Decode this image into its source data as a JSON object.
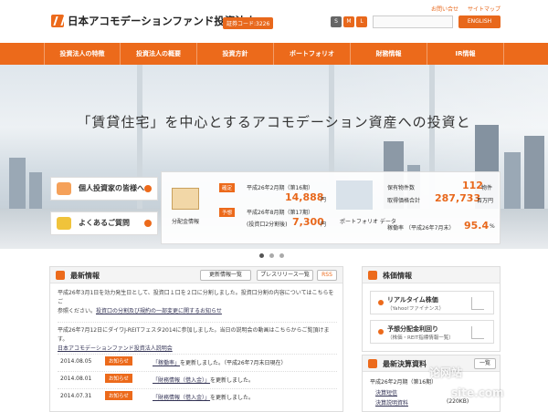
{
  "header": {
    "logo_text": "日本アコモデーションファンド投資法人",
    "stock_code": "証券コード:3226",
    "top_links": [
      "お問い合せ",
      "サイトマップ"
    ],
    "font_sizes": [
      "S",
      "M",
      "L"
    ],
    "english_button": "ENGLISH"
  },
  "nav": {
    "items": [
      "投資法人の特徴",
      "投資法人の概要",
      "投資方針",
      "ポートフォリオ",
      "財務情報",
      "IR情報"
    ]
  },
  "hero": {
    "headline": "「賃貸住宅」を中心とするアコモデーション資産への投資と",
    "left_buttons": [
      "個人投資家の皆様へ",
      "よくあるご質問"
    ],
    "distribution": {
      "label": "分配金情報",
      "confirmed_tag": "確定",
      "confirmed_period": "平成26年2月期（第16期）",
      "confirmed_amount": "14,888",
      "confirmed_unit": "円",
      "forecast_tag": "予想",
      "forecast_period": "平成26年8月期（第17期）",
      "forecast_note": "(投資口2分割後)",
      "forecast_amount": "7,300",
      "forecast_unit": "円"
    },
    "portfolio": {
      "label": "ポートフォリオ データ",
      "holdings_label": "保有物件数",
      "holdings_value": "112",
      "holdings_unit": "物件",
      "acquisition_label": "取得価格合計",
      "acquisition_value": "287,733",
      "acquisition_unit": "百万円",
      "occupancy_label": "稼働率",
      "occupancy_period": "（平成26年7月末）",
      "occupancy_value": "95.4",
      "occupancy_unit": "%"
    }
  },
  "news": {
    "title": "最新情報",
    "buttons": [
      "更新情報一覧",
      "プレスリリース一覧",
      "RSS"
    ],
    "notice1_line1": "平成26年3月1日を効力発生日として、投資口１口を２口に分割しました。投資口分割の内容についてはこちらをご",
    "notice1_line2_prefix": "参照ください。",
    "notice1_link": "投資口の分割及び規約の一部変更に関するお知らせ",
    "notice2_line1": "平成26年7月12日にダイワJ-REITフェスタ2014に参加しました。当日の説明会の動画はこちらからご覧頂けます。",
    "notice2_link": "日本アコモデーションファンド投資法人説明会",
    "rows": [
      {
        "date": "2014.08.05",
        "badge": "お知らせ",
        "text_link": "「稼働率」",
        "text": "を更新しました。（平成26年7月末日現在）"
      },
      {
        "date": "2014.08.01",
        "badge": "お知らせ",
        "text_link": "「財務情報（借入金）」",
        "text": "を更新しました。"
      },
      {
        "date": "2014.07.31",
        "badge": "お知らせ",
        "text_link": "「財務情報（借入金）」",
        "text": "を更新しました。"
      }
    ]
  },
  "stock": {
    "title": "株価情報",
    "realtime_title": "リアルタイム株価",
    "realtime_sub": "（Yahoo!ファイナンス）",
    "dividend_title": "予想分配金利回り",
    "dividend_sub": "（株価・REIT指標情報一覧）"
  },
  "financial": {
    "title": "最新決算資料",
    "list_button": "一覧",
    "period": "平成26年2月期（第16期）",
    "items": [
      "決算短信",
      "決算説明資料"
    ],
    "file_size": "(220KB)"
  },
  "watermark": {
    "text1": "论网站",
    "text2": "site.com"
  }
}
